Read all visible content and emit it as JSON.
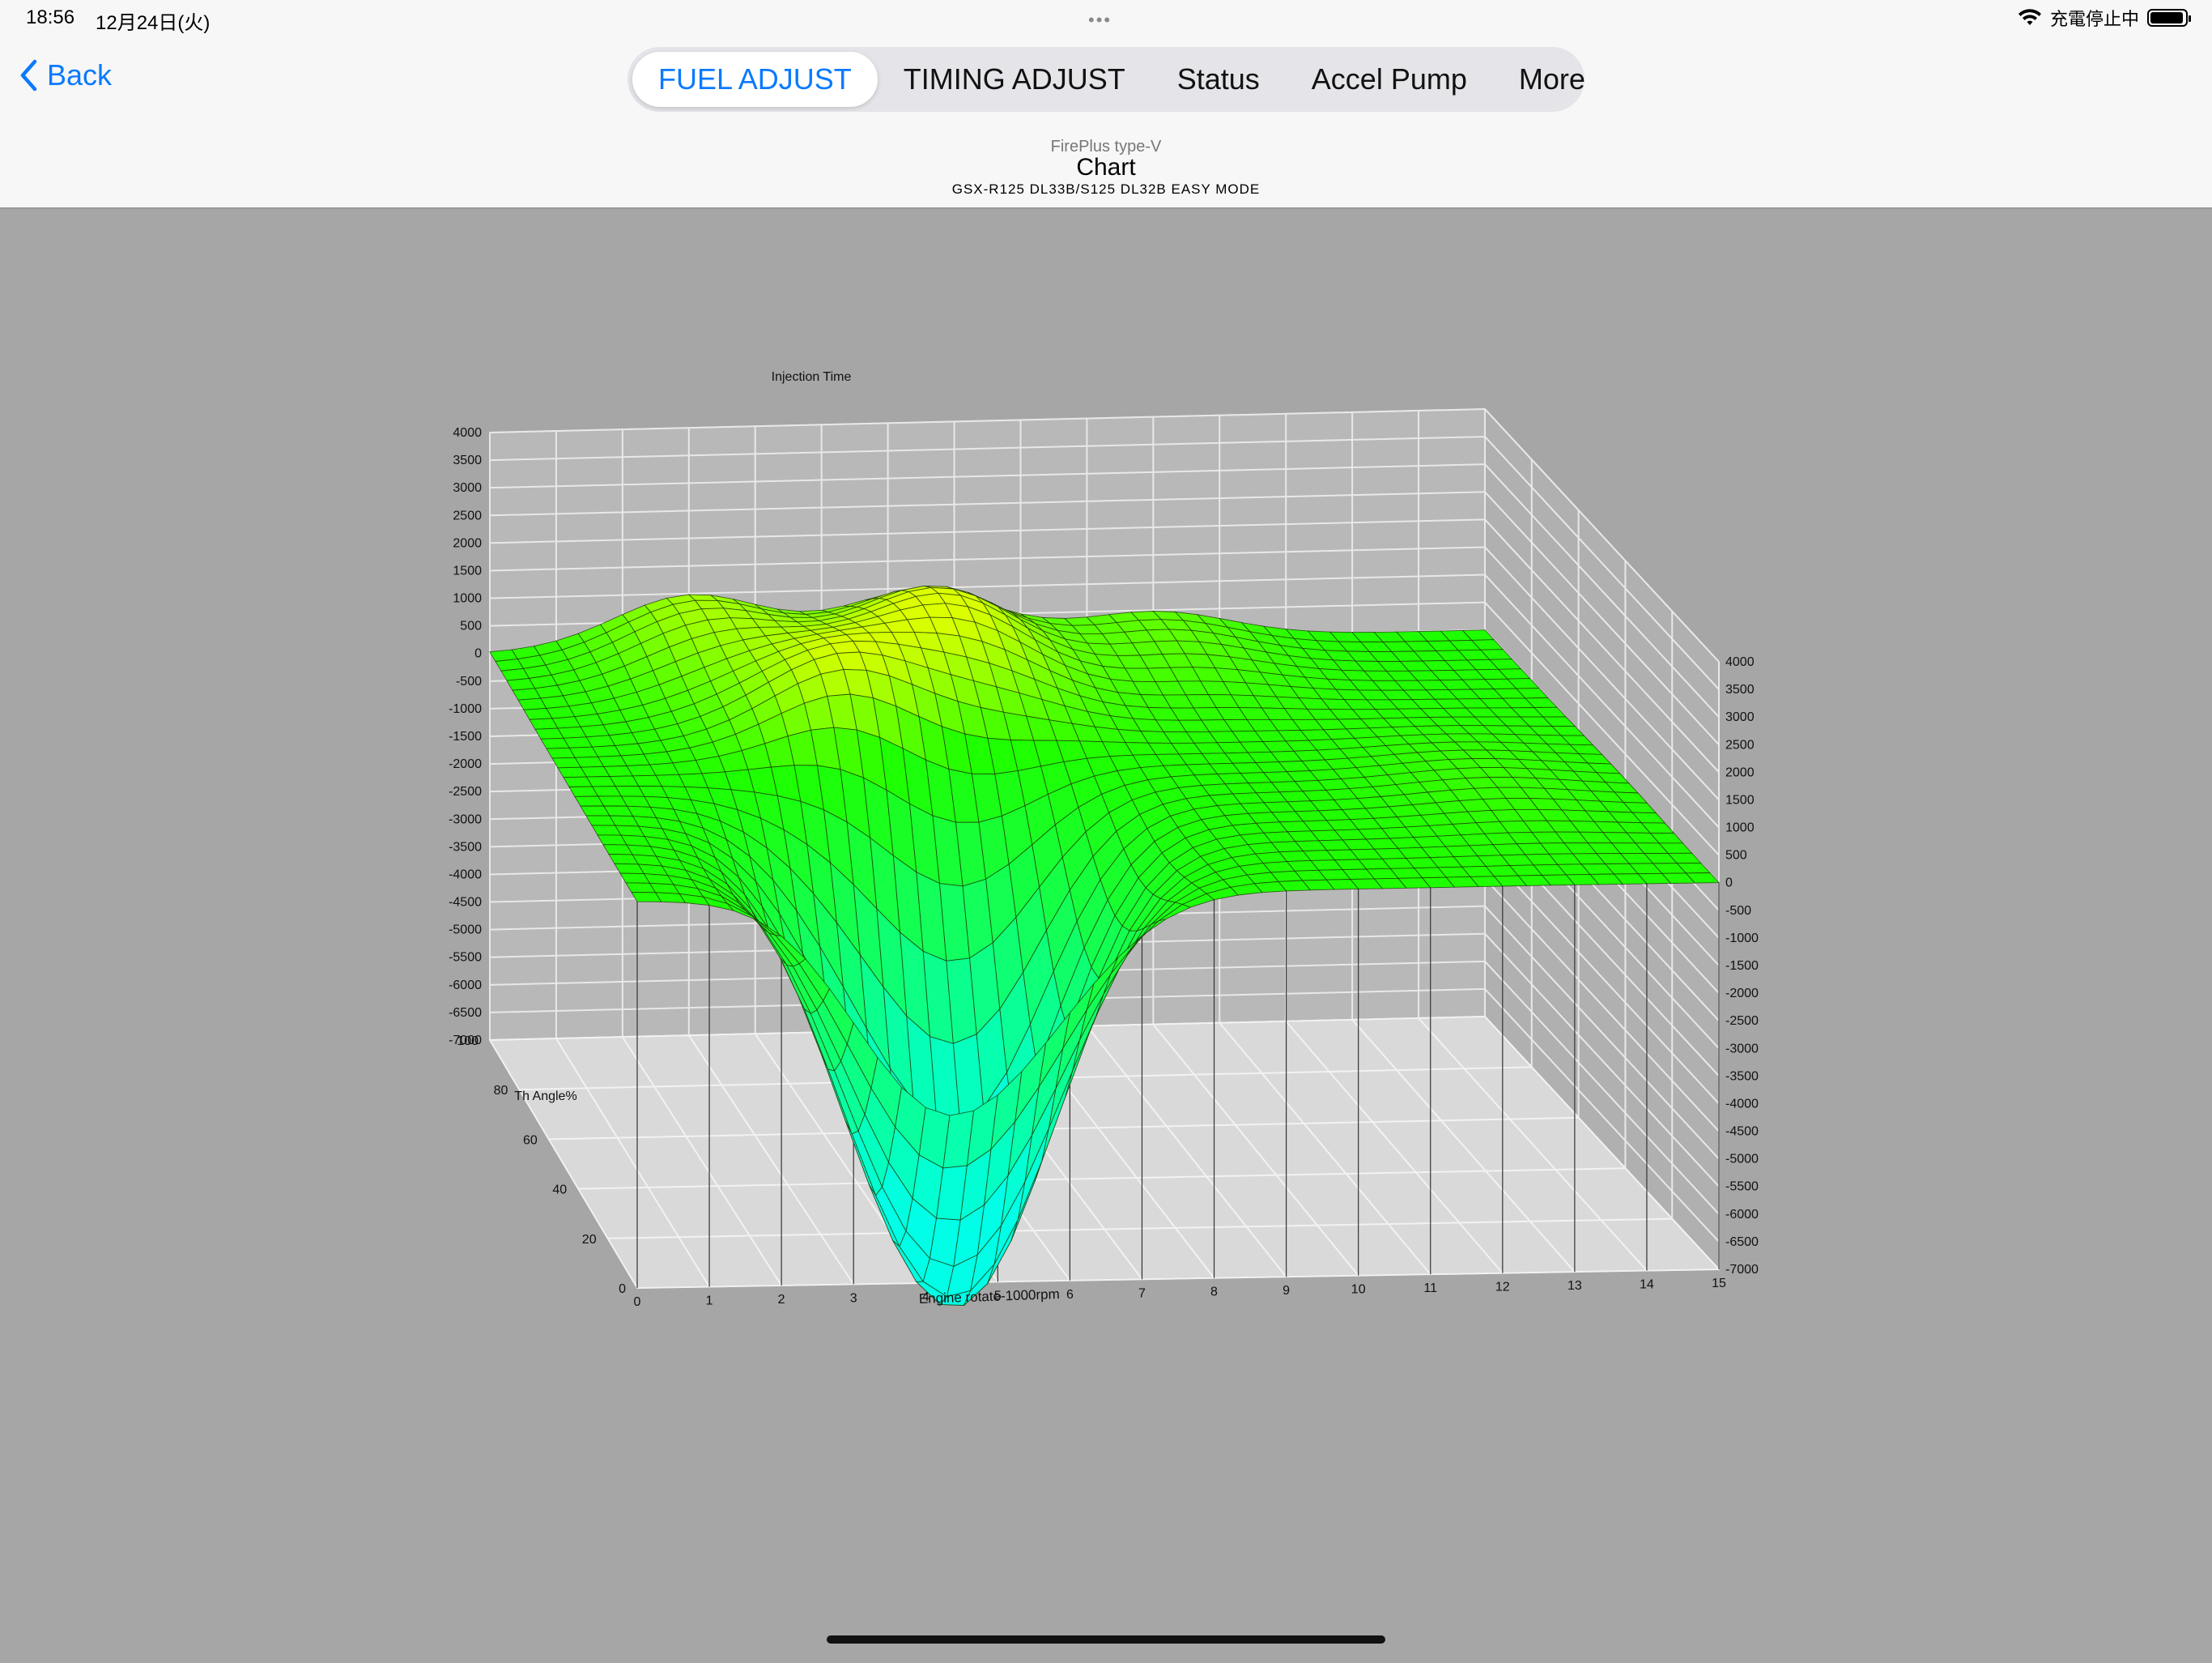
{
  "status": {
    "time": "18:56",
    "date": "12月24日(火)",
    "dots": "•••",
    "charging_text": "充電停止中"
  },
  "nav": {
    "back_label": "Back",
    "tabs": [
      {
        "label": "FUEL ADJUST",
        "active": true
      },
      {
        "label": "TIMING ADJUST",
        "active": false
      },
      {
        "label": "Status",
        "active": false
      },
      {
        "label": "Accel Pump",
        "active": false
      },
      {
        "label": "More",
        "active": false
      }
    ]
  },
  "subtitle": {
    "brand": "FirePlus type-V",
    "title": "Chart",
    "model": "GSX-R125 DL33B/S125 DL32B EASY MODE"
  },
  "colors": {
    "accent": "#0a7aff",
    "surface_high": "#aaff00",
    "surface_mid": "#22ff00",
    "surface_low": "#00ffdd",
    "background": "#a6a6a6"
  },
  "chart_data": {
    "type": "surface",
    "title": "Injection Time",
    "xlabel": "Engine rotate-1000rpm",
    "ylabel": "Th Angle%",
    "x_ticks": [
      "0",
      "1",
      "2",
      "3",
      "4",
      "5",
      "6",
      "7",
      "8",
      "9",
      "10",
      "11",
      "12",
      "13",
      "14",
      "15"
    ],
    "y_ticks": [
      "0",
      "20",
      "40",
      "60",
      "80",
      "100"
    ],
    "z_ticks_left": [
      "4000",
      "3500",
      "3000",
      "2500",
      "2000",
      "1500",
      "1000",
      "500",
      "0",
      "-500",
      "-1000",
      "-1500",
      "-2000",
      "-2500",
      "-3000",
      "-3500",
      "-4000",
      "-4500",
      "-5000",
      "-5500",
      "-6000",
      "-6500",
      "-7000"
    ],
    "z_ticks_right": [
      "4000",
      "3500",
      "3000",
      "2500",
      "2000",
      "1500",
      "1000",
      "500",
      "0",
      "-500",
      "-1000",
      "-1500",
      "-2000",
      "-2500",
      "-3000",
      "-3500",
      "-4000",
      "-4500",
      "-5000",
      "-5500",
      "-6000",
      "-6500",
      "-7000"
    ],
    "xlim": [
      0,
      15
    ],
    "ylim": [
      0,
      100
    ],
    "zlim": [
      -7000,
      4000
    ],
    "grid": true,
    "features": [
      {
        "x": 5.5,
        "y": 25,
        "z": -6000
      },
      {
        "x": 4.0,
        "y": 15,
        "z": -5000
      },
      {
        "x": 4.5,
        "y": 60,
        "z": 1500
      },
      {
        "x": 6.5,
        "y": 85,
        "z": 1500
      },
      {
        "x": 3.0,
        "y": 95,
        "z": 1000
      },
      {
        "x": 10.0,
        "y": 95,
        "z": 500
      },
      {
        "x": 13.0,
        "y": 40,
        "z": 200
      }
    ]
  }
}
